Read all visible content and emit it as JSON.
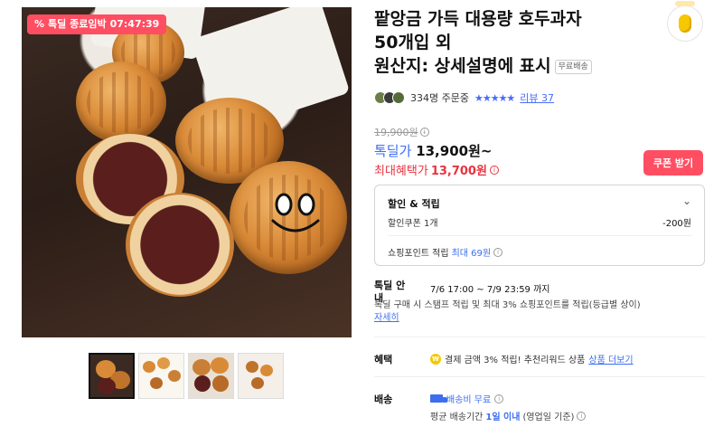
{
  "gallery": {
    "timer_badge": {
      "icon": "percent-icon",
      "label": "톡딜 종료임박",
      "time": "07:47:39"
    },
    "thumbnail_count": 4
  },
  "product": {
    "title_line1": "팥앙금 가득 대용량 호두과자",
    "title_line2": "50개입 외",
    "title_line3": "원산지: 상세설명에 표시",
    "free_shipping_badge": "무료배송"
  },
  "social": {
    "buyers_text": "334명 주문중",
    "stars": "★★★★★",
    "review_label": "리뷰 37"
  },
  "pricing": {
    "original_price": "19,900원",
    "deal_label": "톡딜가",
    "deal_price": "13,900원~",
    "max_benefit_label": "최대혜택가",
    "max_benefit_price": "13,700원"
  },
  "coupon_button": "쿠폰 받기",
  "discount": {
    "header": "할인 & 적립",
    "coupon_label": "할인쿠폰 1개",
    "coupon_value": "-200원",
    "points_label": "쇼핑포인트 적립",
    "points_value": "최대 69원"
  },
  "deal": {
    "label": "톡딜 안내",
    "period": "7/6 17:00 ~ 7/9 23:59 까지",
    "description": "톡딜 구매 시 스탬프 적립 및 최대 3% 쇼핑포인트를 적립(등급별 상이)",
    "detail_link": "자세히"
  },
  "benefit": {
    "label": "혜택",
    "text": "결제 금액 3% 적립! 추천리워드 상품",
    "more_link": "상품 더보기"
  },
  "shipping": {
    "label": "배송",
    "fee": "배송비 무료",
    "avg_prefix": "평균 배송기간",
    "avg_value": "1일 이내",
    "avg_suffix": "(영업일 기준)"
  },
  "colors": {
    "accent_red": "#ff4e62",
    "accent_blue": "#3c6ef0",
    "benefit_red": "#e8333f"
  }
}
